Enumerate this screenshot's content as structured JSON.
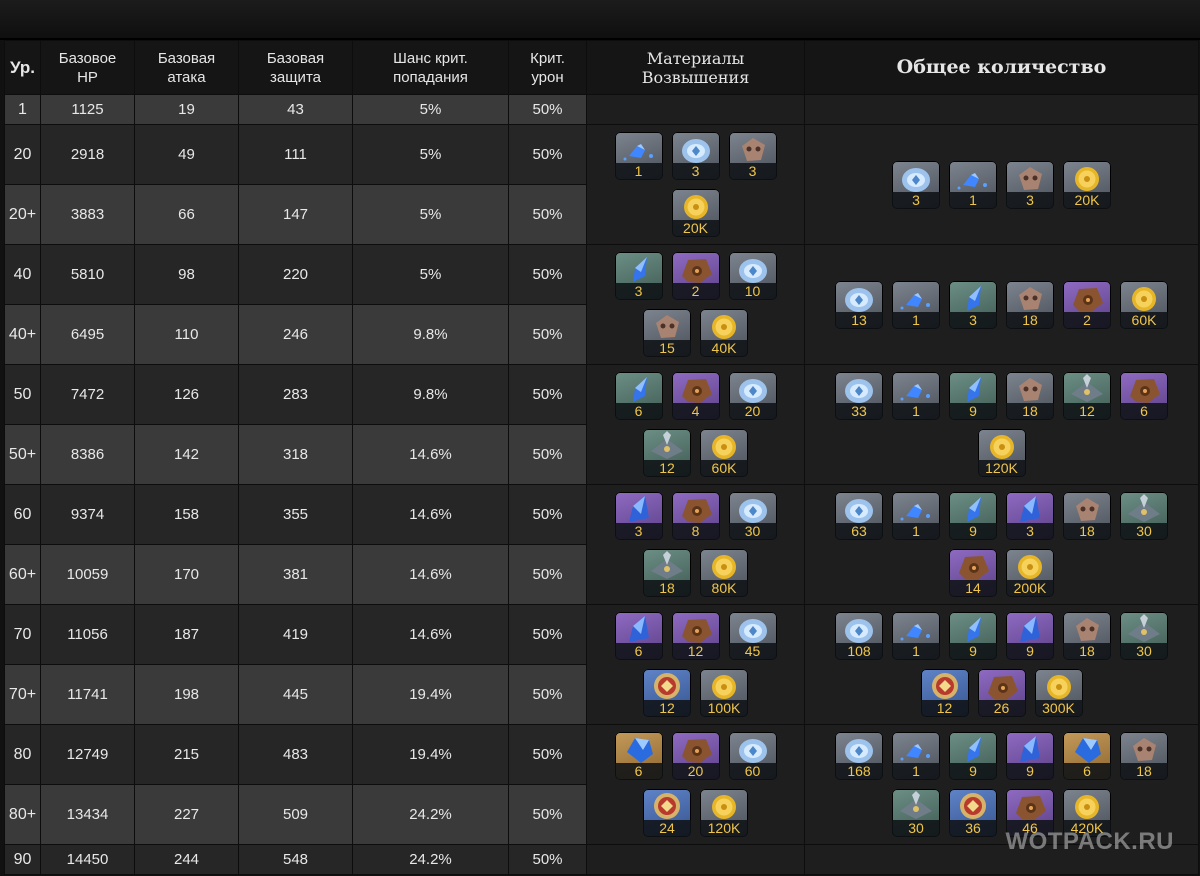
{
  "headers": {
    "level": "Ур.",
    "hp": [
      "Базовое",
      "HP"
    ],
    "atk": [
      "Базовая",
      "атака"
    ],
    "def": [
      "Базовая",
      "защита"
    ],
    "crit_rate": [
      "Шанс крит.",
      "попадания"
    ],
    "crit_dmg": [
      "Крит.",
      "урон"
    ],
    "materials": [
      "Материалы",
      "Возвышения"
    ],
    "total": "Общее количество"
  },
  "rows": [
    {
      "level": "1",
      "hp": "1125",
      "atk": "19",
      "def": "43",
      "crit_rate": "5%",
      "crit_dmg": "50%"
    },
    {
      "level": "20",
      "hp": "2918",
      "atk": "49",
      "def": "111",
      "crit_rate": "5%",
      "crit_dmg": "50%"
    },
    {
      "level": "20+",
      "hp": "3883",
      "atk": "66",
      "def": "147",
      "crit_rate": "5%",
      "crit_dmg": "50%"
    },
    {
      "level": "40",
      "hp": "5810",
      "atk": "98",
      "def": "220",
      "crit_rate": "5%",
      "crit_dmg": "50%"
    },
    {
      "level": "40+",
      "hp": "6495",
      "atk": "110",
      "def": "246",
      "crit_rate": "9.8%",
      "crit_dmg": "50%"
    },
    {
      "level": "50",
      "hp": "7472",
      "atk": "126",
      "def": "283",
      "crit_rate": "9.8%",
      "crit_dmg": "50%"
    },
    {
      "level": "50+",
      "hp": "8386",
      "atk": "142",
      "def": "318",
      "crit_rate": "14.6%",
      "crit_dmg": "50%"
    },
    {
      "level": "60",
      "hp": "9374",
      "atk": "158",
      "def": "355",
      "crit_rate": "14.6%",
      "crit_dmg": "50%"
    },
    {
      "level": "60+",
      "hp": "10059",
      "atk": "170",
      "def": "381",
      "crit_rate": "14.6%",
      "crit_dmg": "50%"
    },
    {
      "level": "70",
      "hp": "11056",
      "atk": "187",
      "def": "419",
      "crit_rate": "14.6%",
      "crit_dmg": "50%"
    },
    {
      "level": "70+",
      "hp": "11741",
      "atk": "198",
      "def": "445",
      "crit_rate": "19.4%",
      "crit_dmg": "50%"
    },
    {
      "level": "80",
      "hp": "12749",
      "atk": "215",
      "def": "483",
      "crit_rate": "19.4%",
      "crit_dmg": "50%"
    },
    {
      "level": "80+",
      "hp": "13434",
      "atk": "227",
      "def": "509",
      "crit_rate": "24.2%",
      "crit_dmg": "50%"
    },
    {
      "level": "90",
      "hp": "14450",
      "atk": "244",
      "def": "548",
      "crit_rate": "24.2%",
      "crit_dmg": "50%"
    }
  ],
  "materials": [
    [
      {
        "icon": "gem-sliver-icon",
        "bg": "gray",
        "count": "1"
      },
      {
        "icon": "slime-orb-icon",
        "bg": "gray",
        "count": "3"
      },
      {
        "icon": "mask-shard-icon",
        "bg": "gray",
        "count": "3"
      },
      {
        "icon": "mora-coin-icon",
        "bg": "gray",
        "count": "20K"
      }
    ],
    [
      {
        "icon": "gem-fragment-icon",
        "bg": "green",
        "count": "3"
      },
      {
        "icon": "boss-material-icon",
        "bg": "purple",
        "count": "2"
      },
      {
        "icon": "slime-orb-icon",
        "bg": "gray",
        "count": "10"
      },
      {
        "icon": "mask-shard-icon",
        "bg": "gray",
        "count": "15"
      },
      {
        "icon": "mora-coin-icon",
        "bg": "gray",
        "count": "40K"
      }
    ],
    [
      {
        "icon": "gem-fragment-icon",
        "bg": "green",
        "count": "6"
      },
      {
        "icon": "boss-material-icon",
        "bg": "purple",
        "count": "4"
      },
      {
        "icon": "slime-orb-icon",
        "bg": "gray",
        "count": "20"
      },
      {
        "icon": "mask-emblem-icon",
        "bg": "green",
        "count": "12"
      },
      {
        "icon": "mora-coin-icon",
        "bg": "gray",
        "count": "60K"
      }
    ],
    [
      {
        "icon": "gem-chunk-icon",
        "bg": "purple",
        "count": "3"
      },
      {
        "icon": "boss-material-icon",
        "bg": "purple",
        "count": "8"
      },
      {
        "icon": "slime-orb-icon",
        "bg": "gray",
        "count": "30"
      },
      {
        "icon": "mask-emblem-icon",
        "bg": "green",
        "count": "18"
      },
      {
        "icon": "mora-coin-icon",
        "bg": "gray",
        "count": "80K"
      }
    ],
    [
      {
        "icon": "gem-chunk-icon",
        "bg": "purple",
        "count": "6"
      },
      {
        "icon": "boss-material-icon",
        "bg": "purple",
        "count": "12"
      },
      {
        "icon": "slime-orb-icon",
        "bg": "gray",
        "count": "45"
      },
      {
        "icon": "mask-insignia-icon",
        "bg": "blue",
        "count": "12"
      },
      {
        "icon": "mora-coin-icon",
        "bg": "gray",
        "count": "100K"
      }
    ],
    [
      {
        "icon": "gemstone-icon",
        "bg": "gold",
        "count": "6"
      },
      {
        "icon": "boss-material-icon",
        "bg": "purple",
        "count": "20"
      },
      {
        "icon": "slime-orb-icon",
        "bg": "gray",
        "count": "60"
      },
      {
        "icon": "mask-insignia-icon",
        "bg": "blue",
        "count": "24"
      },
      {
        "icon": "mora-coin-icon",
        "bg": "gray",
        "count": "120K"
      }
    ]
  ],
  "totals": [
    [
      {
        "icon": "slime-orb-icon",
        "bg": "gray",
        "count": "3"
      },
      {
        "icon": "gem-sliver-icon",
        "bg": "gray",
        "count": "1"
      },
      {
        "icon": "mask-shard-icon",
        "bg": "gray",
        "count": "3"
      },
      {
        "icon": "mora-coin-icon",
        "bg": "gray",
        "count": "20K"
      }
    ],
    [
      {
        "icon": "slime-orb-icon",
        "bg": "gray",
        "count": "13"
      },
      {
        "icon": "gem-sliver-icon",
        "bg": "gray",
        "count": "1"
      },
      {
        "icon": "gem-fragment-icon",
        "bg": "green",
        "count": "3"
      },
      {
        "icon": "mask-shard-icon",
        "bg": "gray",
        "count": "18"
      },
      {
        "icon": "boss-material-icon",
        "bg": "purple",
        "count": "2"
      },
      {
        "icon": "mora-coin-icon",
        "bg": "gray",
        "count": "60K"
      }
    ],
    [
      {
        "icon": "slime-orb-icon",
        "bg": "gray",
        "count": "33"
      },
      {
        "icon": "gem-sliver-icon",
        "bg": "gray",
        "count": "1"
      },
      {
        "icon": "gem-fragment-icon",
        "bg": "green",
        "count": "9"
      },
      {
        "icon": "mask-shard-icon",
        "bg": "gray",
        "count": "18"
      },
      {
        "icon": "mask-emblem-icon",
        "bg": "green",
        "count": "12"
      },
      {
        "icon": "boss-material-icon",
        "bg": "purple",
        "count": "6"
      },
      {
        "icon": "mora-coin-icon",
        "bg": "gray",
        "count": "120K"
      }
    ],
    [
      {
        "icon": "slime-orb-icon",
        "bg": "gray",
        "count": "63"
      },
      {
        "icon": "gem-sliver-icon",
        "bg": "gray",
        "count": "1"
      },
      {
        "icon": "gem-fragment-icon",
        "bg": "green",
        "count": "9"
      },
      {
        "icon": "gem-chunk-icon",
        "bg": "purple",
        "count": "3"
      },
      {
        "icon": "mask-shard-icon",
        "bg": "gray",
        "count": "18"
      },
      {
        "icon": "mask-emblem-icon",
        "bg": "green",
        "count": "30"
      },
      {
        "icon": "boss-material-icon",
        "bg": "purple",
        "count": "14"
      },
      {
        "icon": "mora-coin-icon",
        "bg": "gray",
        "count": "200K"
      }
    ],
    [
      {
        "icon": "slime-orb-icon",
        "bg": "gray",
        "count": "108"
      },
      {
        "icon": "gem-sliver-icon",
        "bg": "gray",
        "count": "1"
      },
      {
        "icon": "gem-fragment-icon",
        "bg": "green",
        "count": "9"
      },
      {
        "icon": "gem-chunk-icon",
        "bg": "purple",
        "count": "9"
      },
      {
        "icon": "mask-shard-icon",
        "bg": "gray",
        "count": "18"
      },
      {
        "icon": "mask-emblem-icon",
        "bg": "green",
        "count": "30"
      },
      {
        "icon": "mask-insignia-icon",
        "bg": "blue",
        "count": "12"
      },
      {
        "icon": "boss-material-icon",
        "bg": "purple",
        "count": "26"
      },
      {
        "icon": "mora-coin-icon",
        "bg": "gray",
        "count": "300K"
      }
    ],
    [
      {
        "icon": "slime-orb-icon",
        "bg": "gray",
        "count": "168"
      },
      {
        "icon": "gem-sliver-icon",
        "bg": "gray",
        "count": "1"
      },
      {
        "icon": "gem-fragment-icon",
        "bg": "green",
        "count": "9"
      },
      {
        "icon": "gem-chunk-icon",
        "bg": "purple",
        "count": "9"
      },
      {
        "icon": "gemstone-icon",
        "bg": "gold",
        "count": "6"
      },
      {
        "icon": "mask-shard-icon",
        "bg": "gray",
        "count": "18"
      },
      {
        "icon": "mask-emblem-icon",
        "bg": "green",
        "count": "30"
      },
      {
        "icon": "mask-insignia-icon",
        "bg": "blue",
        "count": "36"
      },
      {
        "icon": "boss-material-icon",
        "bg": "purple",
        "count": "46"
      },
      {
        "icon": "mora-coin-icon",
        "bg": "gray",
        "count": "420K"
      }
    ]
  ],
  "watermark": "WOTPACK.RU"
}
